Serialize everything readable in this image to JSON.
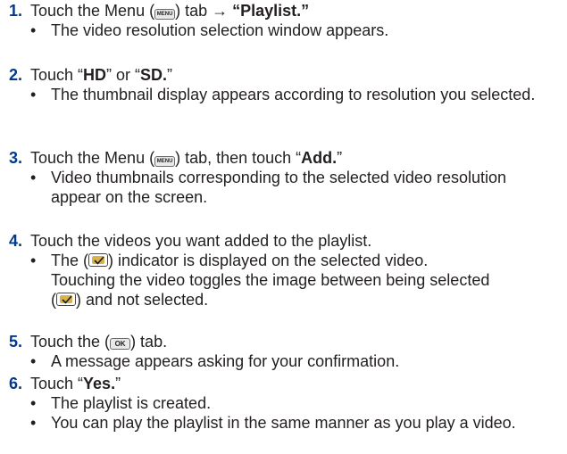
{
  "steps": [
    {
      "number": "1.",
      "line": {
        "t1": "Touch the Menu (",
        "icon": "MENU",
        "t2": ") tab → ",
        "bold": "“Playlist.”"
      },
      "bullets": [
        "The video resolution selection window appears."
      ]
    },
    {
      "number": "2.",
      "line": {
        "t1": "Touch “",
        "b1": "HD",
        "t2": "” or “",
        "b2": "SD.",
        "t3": "”"
      },
      "bullets": [
        "The thumbnail display appears according to resolution you selected."
      ]
    },
    {
      "number": "3.",
      "line": {
        "t1": "Touch the Menu (",
        "icon": "MENU",
        "t2": ") tab, then touch “",
        "bold": "Add.",
        "t3": "”"
      },
      "bullets": [
        "Video thumbnails corresponding to the selected video resolution appear on the screen."
      ]
    },
    {
      "number": "4.",
      "line": {
        "t1": "Touch the videos you want added to the playlist."
      },
      "bullet": {
        "l1a": "The (",
        "l1b": ") indicator is displayed on the selected video.",
        "l2": "Touching the video toggles the image between being selected",
        "l3a": "(",
        "l3b": ") and not selected."
      }
    },
    {
      "number": "5.",
      "line": {
        "t1": "Touch the (",
        "icon": "OK",
        "t2": ") tab."
      },
      "bullets": [
        "A message appears asking for your confirmation."
      ]
    },
    {
      "number": "6.",
      "line": {
        "t1": "Touch “",
        "bold": "Yes.",
        "t2": "”"
      },
      "bullets": [
        "The playlist is created.",
        "You can play the playlist in the same manner as you play a video."
      ]
    }
  ],
  "bullet_glyph": "•"
}
